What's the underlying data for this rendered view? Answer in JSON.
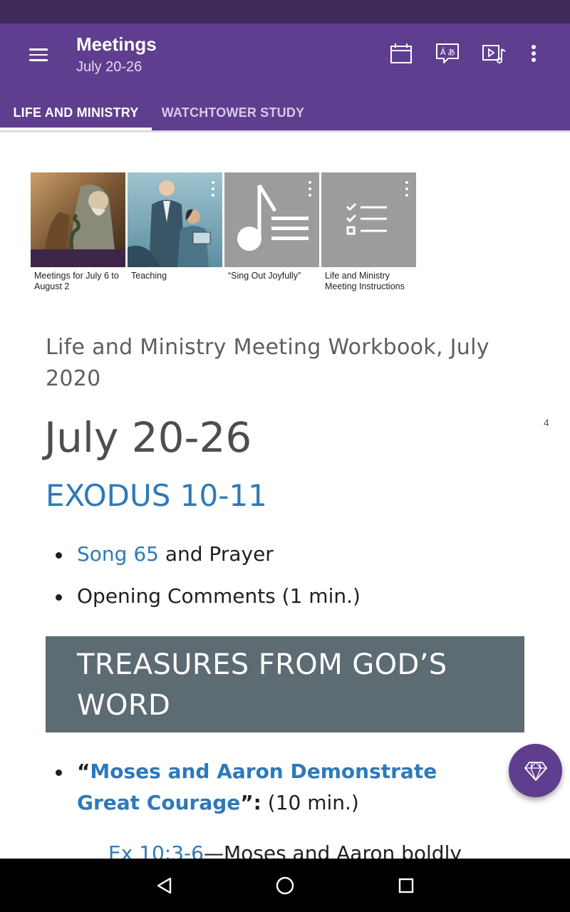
{
  "app": {
    "title": "Meetings",
    "subtitle": "July 20-26"
  },
  "toolbar": {
    "icons": [
      "menu-icon",
      "calendar-icon",
      "language-icon",
      "media-icon",
      "more-icon"
    ]
  },
  "tabs": [
    {
      "label": "LIFE AND MINISTRY",
      "active": true
    },
    {
      "label": "WATCHTOWER STUDY",
      "active": false
    }
  ],
  "media": [
    {
      "caption": "Meetings for July 6 to August 2"
    },
    {
      "caption": "Teaching"
    },
    {
      "caption": "“Sing Out Joyfully”"
    },
    {
      "caption": "Life and Ministry Meeting Instructions"
    }
  ],
  "article": {
    "workbook_title": "Life and Ministry Meeting Workbook, July 2020",
    "page_number": "4",
    "week": "July 20-26",
    "scripture": "EXODUS 10-11",
    "opening": [
      {
        "link": "Song 65",
        "text": " and Prayer"
      },
      {
        "link": "",
        "text": "Opening Comments (1 min.)"
      }
    ],
    "section_header_line1": "TREASURES FROM GOD’S",
    "section_header_line2": "WORD",
    "treasure_open_quote": "“",
    "treasure_link": "Moses and Aaron Demonstrate Great Courage",
    "treasure_close": "”:",
    "treasure_time": " (10 min.)",
    "sub_link": "Ex 10:3-6",
    "sub_text": "—Moses and Aaron boldly"
  },
  "colors": {
    "app_bar": "#5f3e8f",
    "status_bar": "#3f2a5c",
    "link": "#2e79b9",
    "section_header": "#5d6b72"
  }
}
